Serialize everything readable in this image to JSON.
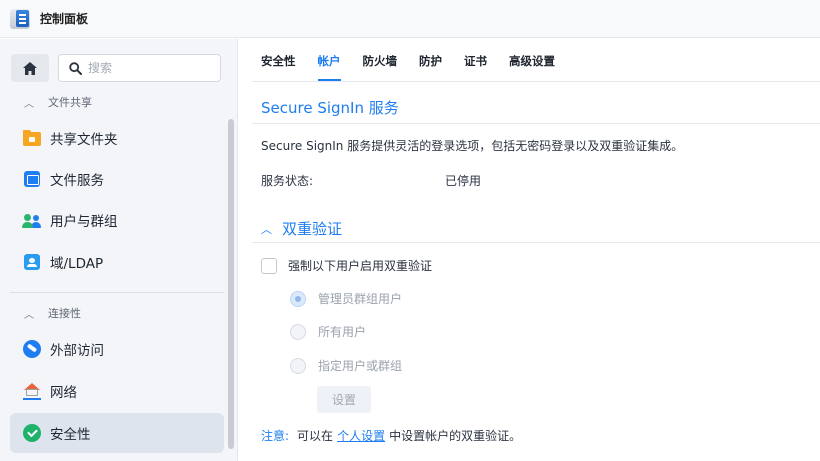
{
  "window": {
    "title": "控制面板",
    "icon": "control-panel-icon"
  },
  "sidebar": {
    "home_icon": "home-icon",
    "search": {
      "placeholder": "搜索",
      "value": "",
      "icon": "search-icon"
    },
    "sections": [
      {
        "label": "文件共享",
        "items": [
          {
            "label": "共享文件夹",
            "icon": "shared-folder-icon"
          },
          {
            "label": "文件服务",
            "icon": "file-services-icon"
          },
          {
            "label": "用户与群组",
            "icon": "users-groups-icon"
          },
          {
            "label": "域/LDAP",
            "icon": "domain-ldap-icon"
          }
        ]
      },
      {
        "label": "连接性",
        "items": [
          {
            "label": "外部访问",
            "icon": "external-access-icon"
          },
          {
            "label": "网络",
            "icon": "network-icon"
          },
          {
            "label": "安全性",
            "icon": "security-icon",
            "active": true
          }
        ]
      }
    ]
  },
  "main": {
    "tabs": [
      {
        "label": "安全性"
      },
      {
        "label": "帐户",
        "active": true
      },
      {
        "label": "防火墙"
      },
      {
        "label": "防护"
      },
      {
        "label": "证书"
      },
      {
        "label": "高级设置"
      }
    ],
    "secure_signin": {
      "title": "Secure SignIn 服务",
      "description": "Secure SignIn 服务提供灵活的登录选项，包括无密码登录以及双重验证集成。",
      "status_label": "服务状态:",
      "status_value": "已停用"
    },
    "two_factor": {
      "title": "双重验证",
      "enforce_label": "强制以下用户启用双重验证",
      "enforce_checked": false,
      "options": [
        {
          "label": "管理员群组用户",
          "checked": true
        },
        {
          "label": "所有用户",
          "checked": false
        },
        {
          "label": "指定用户或群组",
          "checked": false
        }
      ],
      "settings_button": "设置"
    },
    "note": {
      "label": "注意:",
      "prefix": "可以在",
      "link": "个人设置",
      "suffix": "中设置帐户的双重验证。"
    }
  },
  "colors": {
    "accent": "#1e7ef1",
    "sidebar_bg": "#f3f5f8",
    "active_item_bg": "#dde4ee"
  }
}
